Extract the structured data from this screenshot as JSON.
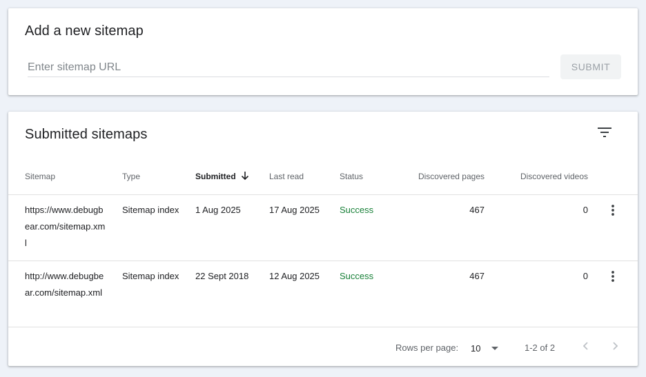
{
  "add_sitemap": {
    "title": "Add a new sitemap",
    "input_placeholder": "Enter sitemap URL",
    "input_value": "",
    "submit_label": "SUBMIT"
  },
  "submitted": {
    "title": "Submitted sitemaps",
    "filter_icon": "filter-icon",
    "columns": {
      "sitemap": "Sitemap",
      "type": "Type",
      "submitted": "Submitted",
      "last_read": "Last read",
      "status": "Status",
      "discovered_pages": "Discovered pages",
      "discovered_videos": "Discovered videos"
    },
    "sort_icon": "arrow-down-icon",
    "rows": [
      {
        "sitemap": "https://www.debugbear.com/sitemap.xml",
        "type": "Sitemap index",
        "submitted": "1 Aug 2025",
        "last_read": "17 Aug 2025",
        "status": "Success",
        "discovered_pages": "467",
        "discovered_videos": "0"
      },
      {
        "sitemap": "http://www.debugbear.com/sitemap.xml",
        "type": "Sitemap index",
        "submitted": "22 Sept 2018",
        "last_read": "12 Aug 2025",
        "status": "Success",
        "discovered_pages": "467",
        "discovered_videos": "0"
      }
    ],
    "footer": {
      "rows_per_page_label": "Rows per page:",
      "rows_per_page_value": "10",
      "range": "1-2 of 2"
    }
  },
  "colors": {
    "background": "#eef2f8",
    "success": "#188038",
    "muted_text": "#5f6368",
    "disabled_button_bg": "#f1f3f4",
    "disabled_button_text": "#9aa0a6"
  }
}
